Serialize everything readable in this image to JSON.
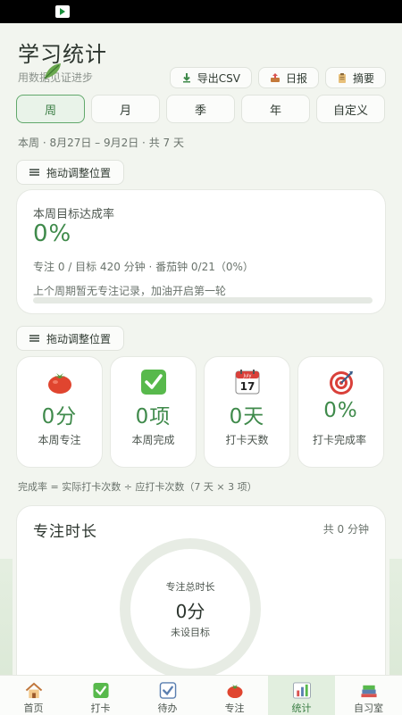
{
  "header": {
    "title": "学习统计",
    "subtitle": "用数据见证进步",
    "actions": [
      {
        "label": "导出CSV",
        "icon": "download-icon"
      },
      {
        "label": "日报",
        "icon": "upload-tray-icon"
      },
      {
        "label": "摘要",
        "icon": "clipboard-icon"
      }
    ]
  },
  "period_tabs": [
    {
      "label": "周",
      "active": true
    },
    {
      "label": "月",
      "active": false
    },
    {
      "label": "季",
      "active": false
    },
    {
      "label": "年",
      "active": false
    },
    {
      "label": "自定义",
      "active": false
    }
  ],
  "range_text": "本周 · 8月27日 – 9月2日 · 共 7 天",
  "drag_chip_label": "拖动调整位置",
  "goal": {
    "label": "本周目标达成率",
    "rate": "0%",
    "detail": "专注 0 / 目标 420 分钟 · 番茄钟 0/21（0%）",
    "encourage": "上个周期暂无专注记录，加油开启第一轮",
    "progress": 0
  },
  "stats": [
    {
      "icon": "tomato-icon",
      "value": "0分",
      "label": "本周专注"
    },
    {
      "icon": "check-box-icon",
      "value": "0项",
      "label": "本周完成"
    },
    {
      "icon": "calendar-icon",
      "value": "0天",
      "label": "打卡天数",
      "calendar_month": "July",
      "calendar_day": "17"
    },
    {
      "icon": "target-icon",
      "value": "0%",
      "label": "打卡完成率"
    }
  ],
  "formula": "完成率 = 实际打卡次数 ÷ 应打卡次数（7 天 × 3 项）",
  "focus": {
    "title": "专注时长",
    "total": "共 0 分钟",
    "ring_label": "专注总时长",
    "ring_value": "0分",
    "ring_sub": "未设目标"
  },
  "nav": [
    {
      "label": "首页",
      "icon": "house-icon",
      "active": false
    },
    {
      "label": "打卡",
      "icon": "check-box-icon",
      "active": false
    },
    {
      "label": "待办",
      "icon": "checkbox-todo-icon",
      "active": false
    },
    {
      "label": "专注",
      "icon": "tomato-icon",
      "active": false
    },
    {
      "label": "统计",
      "icon": "bar-chart-icon",
      "active": true
    },
    {
      "label": "自习室",
      "icon": "books-icon",
      "active": false
    }
  ],
  "colors": {
    "accent": "#3f8a4b",
    "background": "#f2f5ef",
    "active_tab": "#e9f3e9"
  }
}
